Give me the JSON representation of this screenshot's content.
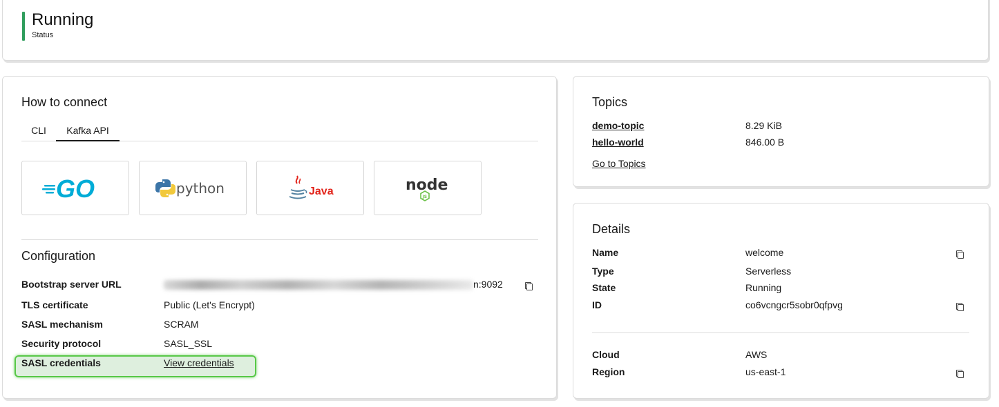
{
  "status": {
    "value": "Running",
    "label": "Status",
    "color": "#2f9d5c"
  },
  "connect": {
    "title": "How to connect",
    "tabs": [
      {
        "label": "CLI",
        "active": false
      },
      {
        "label": "Kafka API",
        "active": true
      }
    ],
    "languages": [
      {
        "name": "GO",
        "icon": "go-logo-icon"
      },
      {
        "name": "python",
        "icon": "python-logo-icon"
      },
      {
        "name": "Java",
        "icon": "java-logo-icon"
      },
      {
        "name": "node",
        "icon": "nodejs-logo-icon"
      }
    ]
  },
  "configuration": {
    "title": "Configuration",
    "rows": [
      {
        "label": "Bootstrap server URL",
        "value_suffix": "n:9092",
        "copy_icon": "copy-icon"
      },
      {
        "label": "TLS certificate",
        "value": "Public (Let's Encrypt)"
      },
      {
        "label": "SASL mechanism",
        "value": "SCRAM"
      },
      {
        "label": "Security protocol",
        "value": "SASL_SSL"
      },
      {
        "label": "SASL credentials",
        "link": "View credentials"
      }
    ],
    "highlight_color": "#58c848"
  },
  "topics": {
    "title": "Topics",
    "items": [
      {
        "name": "demo-topic",
        "size": "8.29 KiB"
      },
      {
        "name": "hello-world",
        "size": "846.00 B"
      }
    ],
    "link": "Go to Topics"
  },
  "details": {
    "title": "Details",
    "rows": [
      {
        "label": "Name",
        "value": "welcome",
        "copy": true
      },
      {
        "label": "Type",
        "value": "Serverless",
        "copy": false
      },
      {
        "label": "State",
        "value": "Running",
        "copy": false
      },
      {
        "label": "ID",
        "value": "co6vcngcr5sobr0qfpvg",
        "copy": true
      }
    ],
    "cloud_rows": [
      {
        "label": "Cloud",
        "value": "AWS",
        "copy": false
      },
      {
        "label": "Region",
        "value": "us-east-1",
        "copy": true
      }
    ]
  }
}
